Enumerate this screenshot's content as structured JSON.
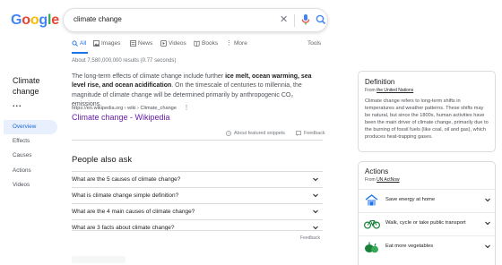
{
  "logo": {
    "letters": [
      "G",
      "o",
      "o",
      "g",
      "l",
      "e"
    ],
    "colors": [
      "#4285F4",
      "#EA4335",
      "#FBBC05",
      "#4285F4",
      "#34A853",
      "#EA4335"
    ]
  },
  "search": {
    "query": "climate change"
  },
  "tabs": [
    {
      "label": "All",
      "icon": "search-icon"
    },
    {
      "label": "Images",
      "icon": "image-icon"
    },
    {
      "label": "News",
      "icon": "news-icon"
    },
    {
      "label": "Videos",
      "icon": "video-icon"
    },
    {
      "label": "Books",
      "icon": "book-icon"
    },
    {
      "label": "More",
      "icon": "more-dots-icon"
    }
  ],
  "tools_label": "Tools",
  "result_stats": "About 7,580,000,000 results (0.77 seconds)",
  "left_panel": {
    "title": "Climate change",
    "dots": "...",
    "items": [
      "Overview",
      "Effects",
      "Causes",
      "Actions",
      "Videos"
    ]
  },
  "snippet": {
    "text_before": "The long-term effects of climate change include further ",
    "text_bold": "ice melt, ocean warming, sea level rise, and ocean acidification",
    "text_after": ". On the timescale of centuries to millennia, the magnitude of climate change will be determined primarily by anthropogenic CO₂ emissions.",
    "source_url": "https://en.wikipedia.org › wiki › Climate_change",
    "link_title": "Climate change - Wikipedia",
    "about_label": "About featured snippets",
    "feedback_label": "Feedback"
  },
  "paa": {
    "heading": "People also ask",
    "questions": [
      "What are the 5 causes of climate change?",
      "What is climate change simple definition?",
      "What are the 4 main causes of climate change?",
      "What are 3 facts about climate change?"
    ],
    "feedback_label": "Feedback"
  },
  "definition": {
    "heading": "Definition",
    "from_prefix": "From ",
    "from_source": "the United Nations",
    "body": "Climate change refers to long-term shifts in temperatures and weather patterns. These shifts may be natural, but since the 1800s, human activities have been the main driver of climate change, primarily due to the burning of fossil fuels (like coal, oil and gas), which produces heat-trapping gases."
  },
  "actions": {
    "heading": "Actions",
    "from_prefix": "From ",
    "from_source": "UN ActNow",
    "items": [
      {
        "label": "Save energy at home",
        "icon": "house-icon"
      },
      {
        "label": "Walk, cycle or take public transport",
        "icon": "bicycle-icon"
      },
      {
        "label": "Eat more vegetables",
        "icon": "vegetables-icon"
      }
    ]
  },
  "colors": {
    "accent": "#1a73e8",
    "visited_link": "#681da8",
    "nav_active_bg": "#e8f0fe"
  }
}
